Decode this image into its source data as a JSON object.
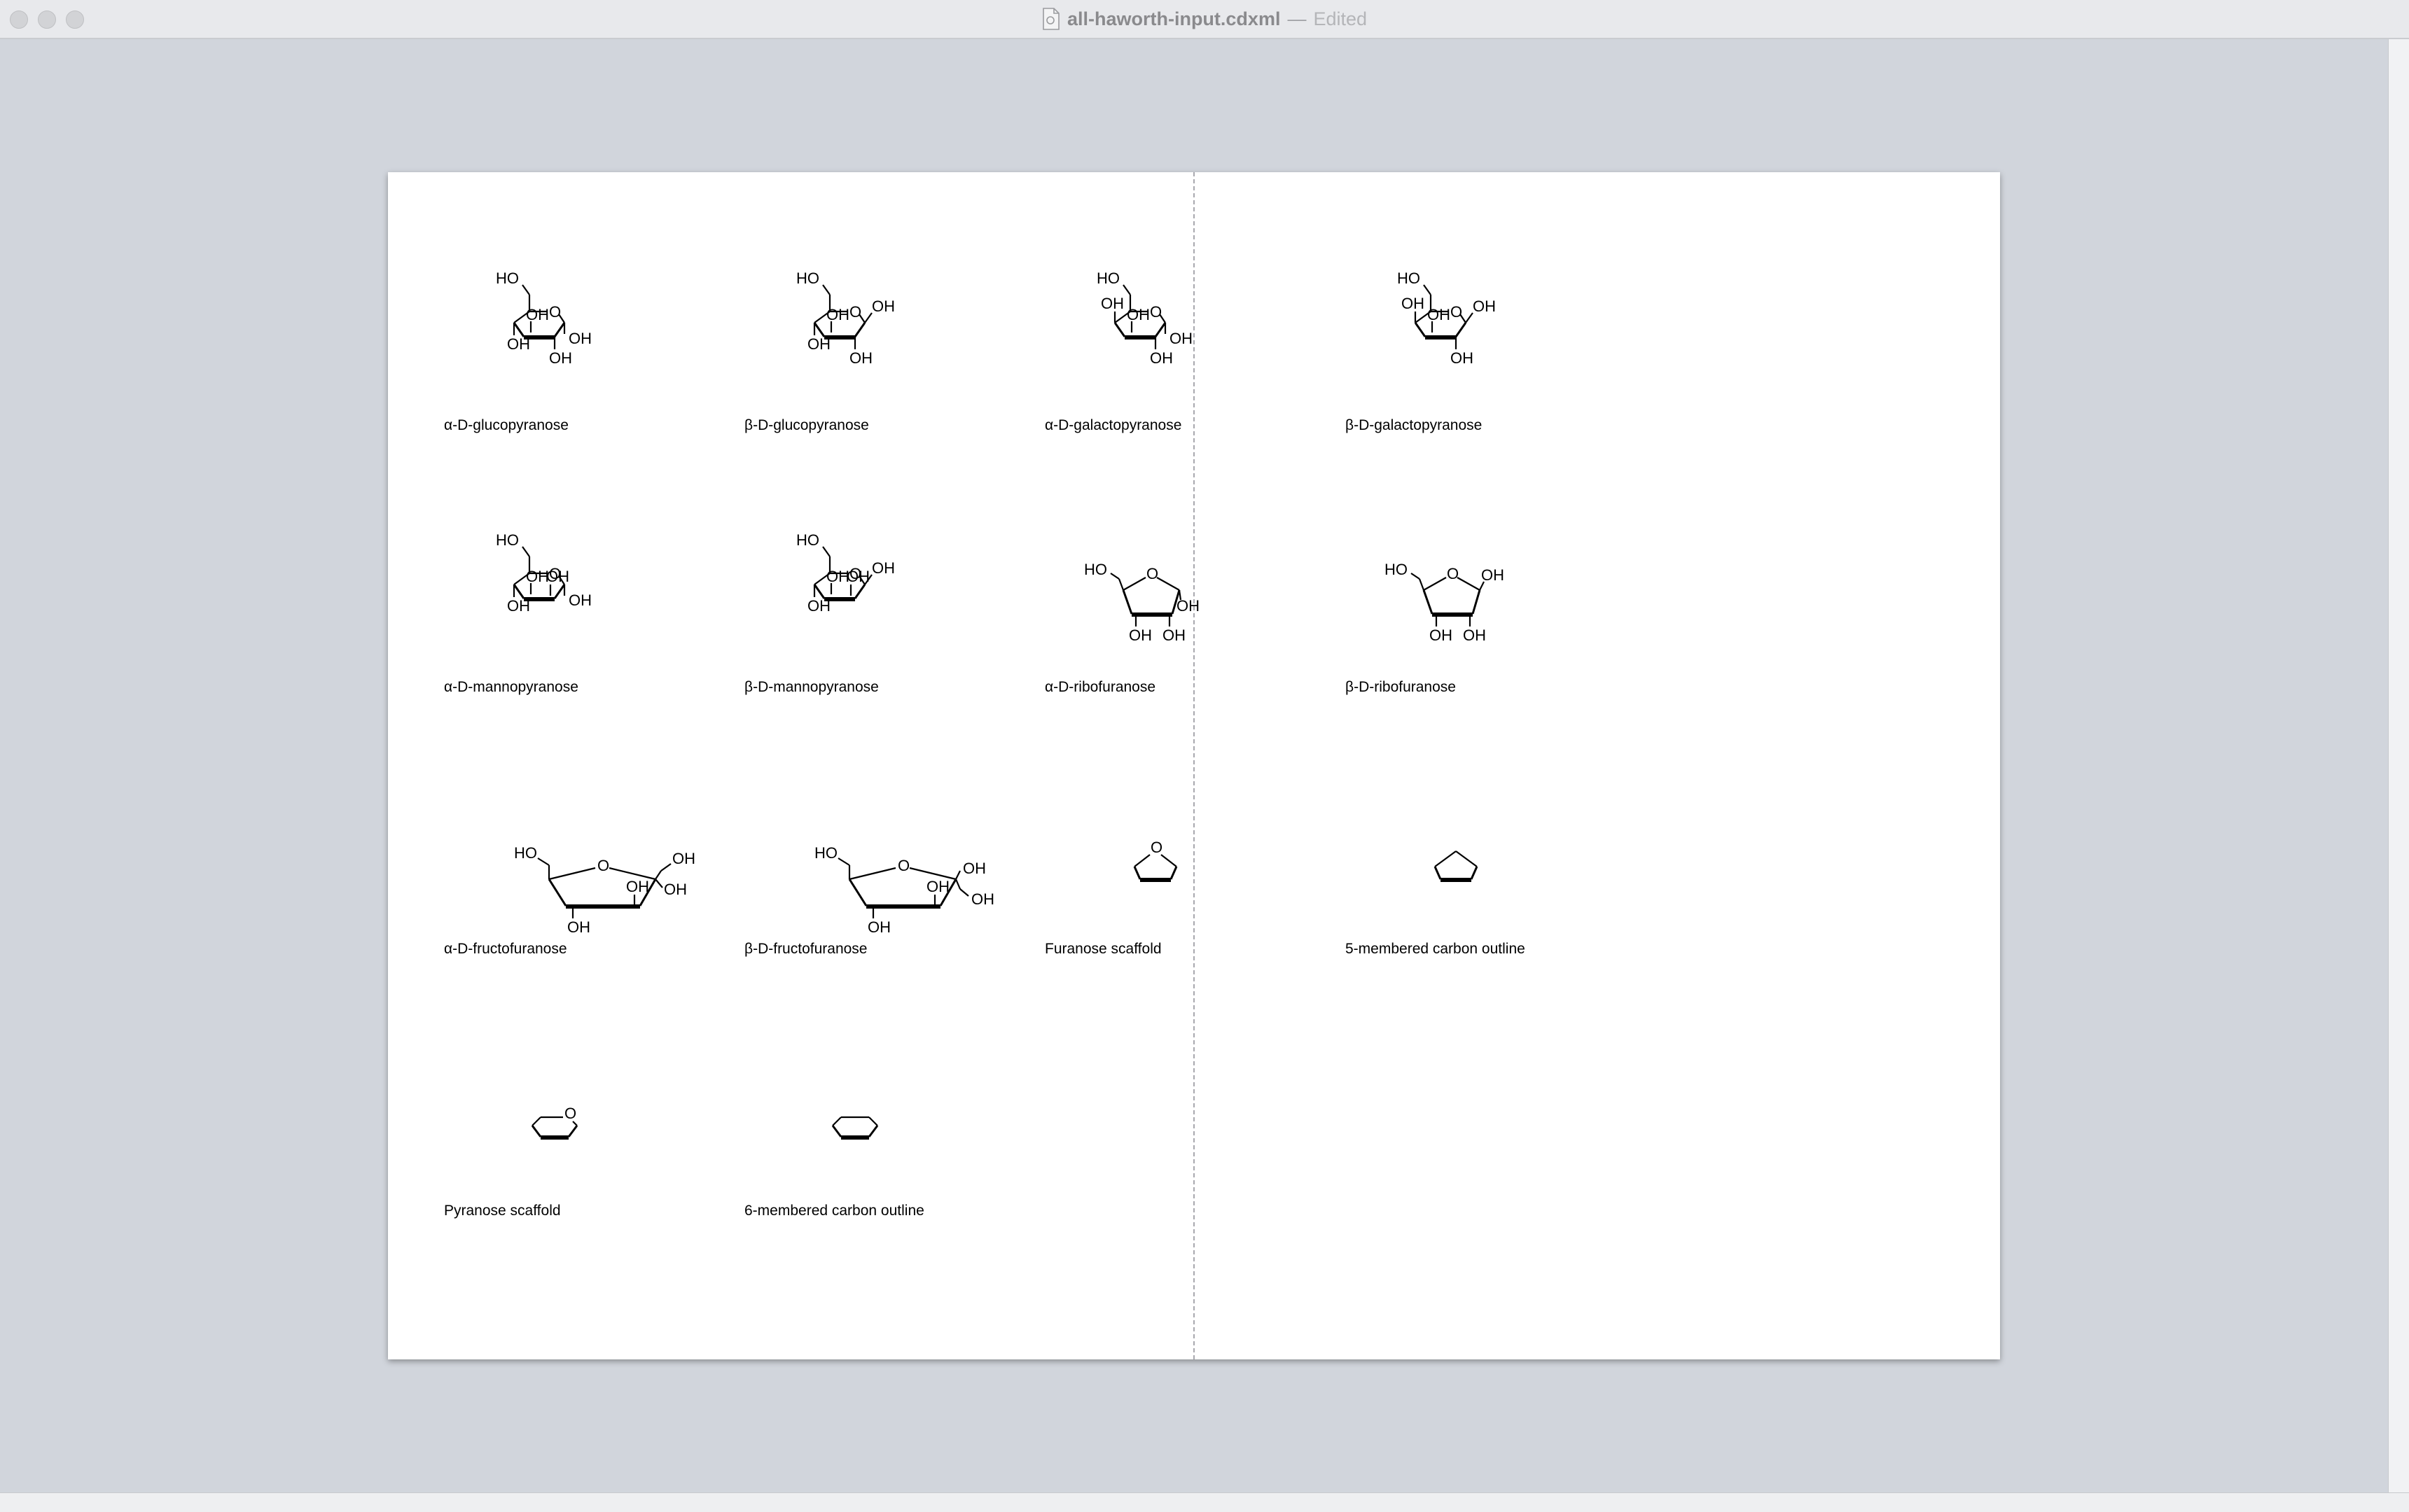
{
  "window": {
    "filename": "all-haworth-input.cdxml",
    "separator": "—",
    "status": "Edited"
  },
  "molecules": [
    {
      "id": "a-glc",
      "name": "α-D-glucopyranose"
    },
    {
      "id": "b-glc",
      "name": "β-D-glucopyranose"
    },
    {
      "id": "a-gal",
      "name": "α-D-galactopyranose"
    },
    {
      "id": "b-gal",
      "name": "β-D-galactopyranose"
    },
    {
      "id": "a-man",
      "name": "α-D-mannopyranose"
    },
    {
      "id": "b-man",
      "name": "β-D-mannopyranose"
    },
    {
      "id": "a-rib",
      "name": "α-D-ribofuranose"
    },
    {
      "id": "b-rib",
      "name": "β-D-ribofuranose"
    },
    {
      "id": "a-fru",
      "name": "α-D-fructofuranose"
    },
    {
      "id": "b-fru",
      "name": "β-D-fructofuranose"
    },
    {
      "id": "fur",
      "name": "Furanose scaffold"
    },
    {
      "id": "c5",
      "name": "5-membered carbon outline"
    },
    {
      "id": "pyr",
      "name": "Pyranose scaffold"
    },
    {
      "id": "c6",
      "name": "6-membered carbon outline"
    }
  ],
  "atom_labels": {
    "ho": "HO",
    "oh": "OH",
    "o": "O"
  }
}
